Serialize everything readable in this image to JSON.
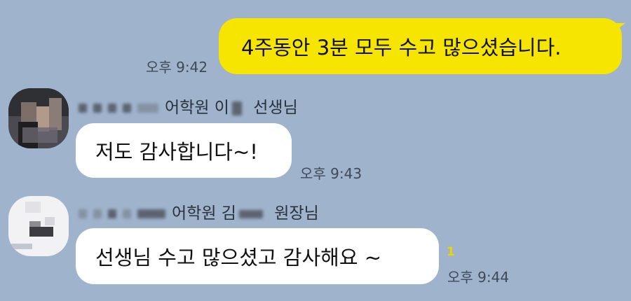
{
  "messages": [
    {
      "sender": "me",
      "text": "4주동안 3분 모두 수고 많으셨습니다.",
      "time": "오후 9:42"
    },
    {
      "sender": "other",
      "name_visible": "어학원 이",
      "name_suffix": "선생님",
      "text": "저도 감사합니다~!",
      "time": "오후 9:43"
    },
    {
      "sender": "other",
      "name_visible": "어학원 김",
      "name_suffix": "원장님",
      "text": "선생님 수고 많으셨고 감사해요 ~",
      "time": "오후 9:44",
      "unread_count": "1"
    }
  ],
  "colors": {
    "background": "#9fb3cc",
    "my_bubble": "#f6e500",
    "other_bubble": "#ffffff",
    "unread": "#e8d400"
  },
  "icons": {
    "avatar1": "profile-photo-blurred",
    "avatar2": "profile-photo-blurred"
  }
}
